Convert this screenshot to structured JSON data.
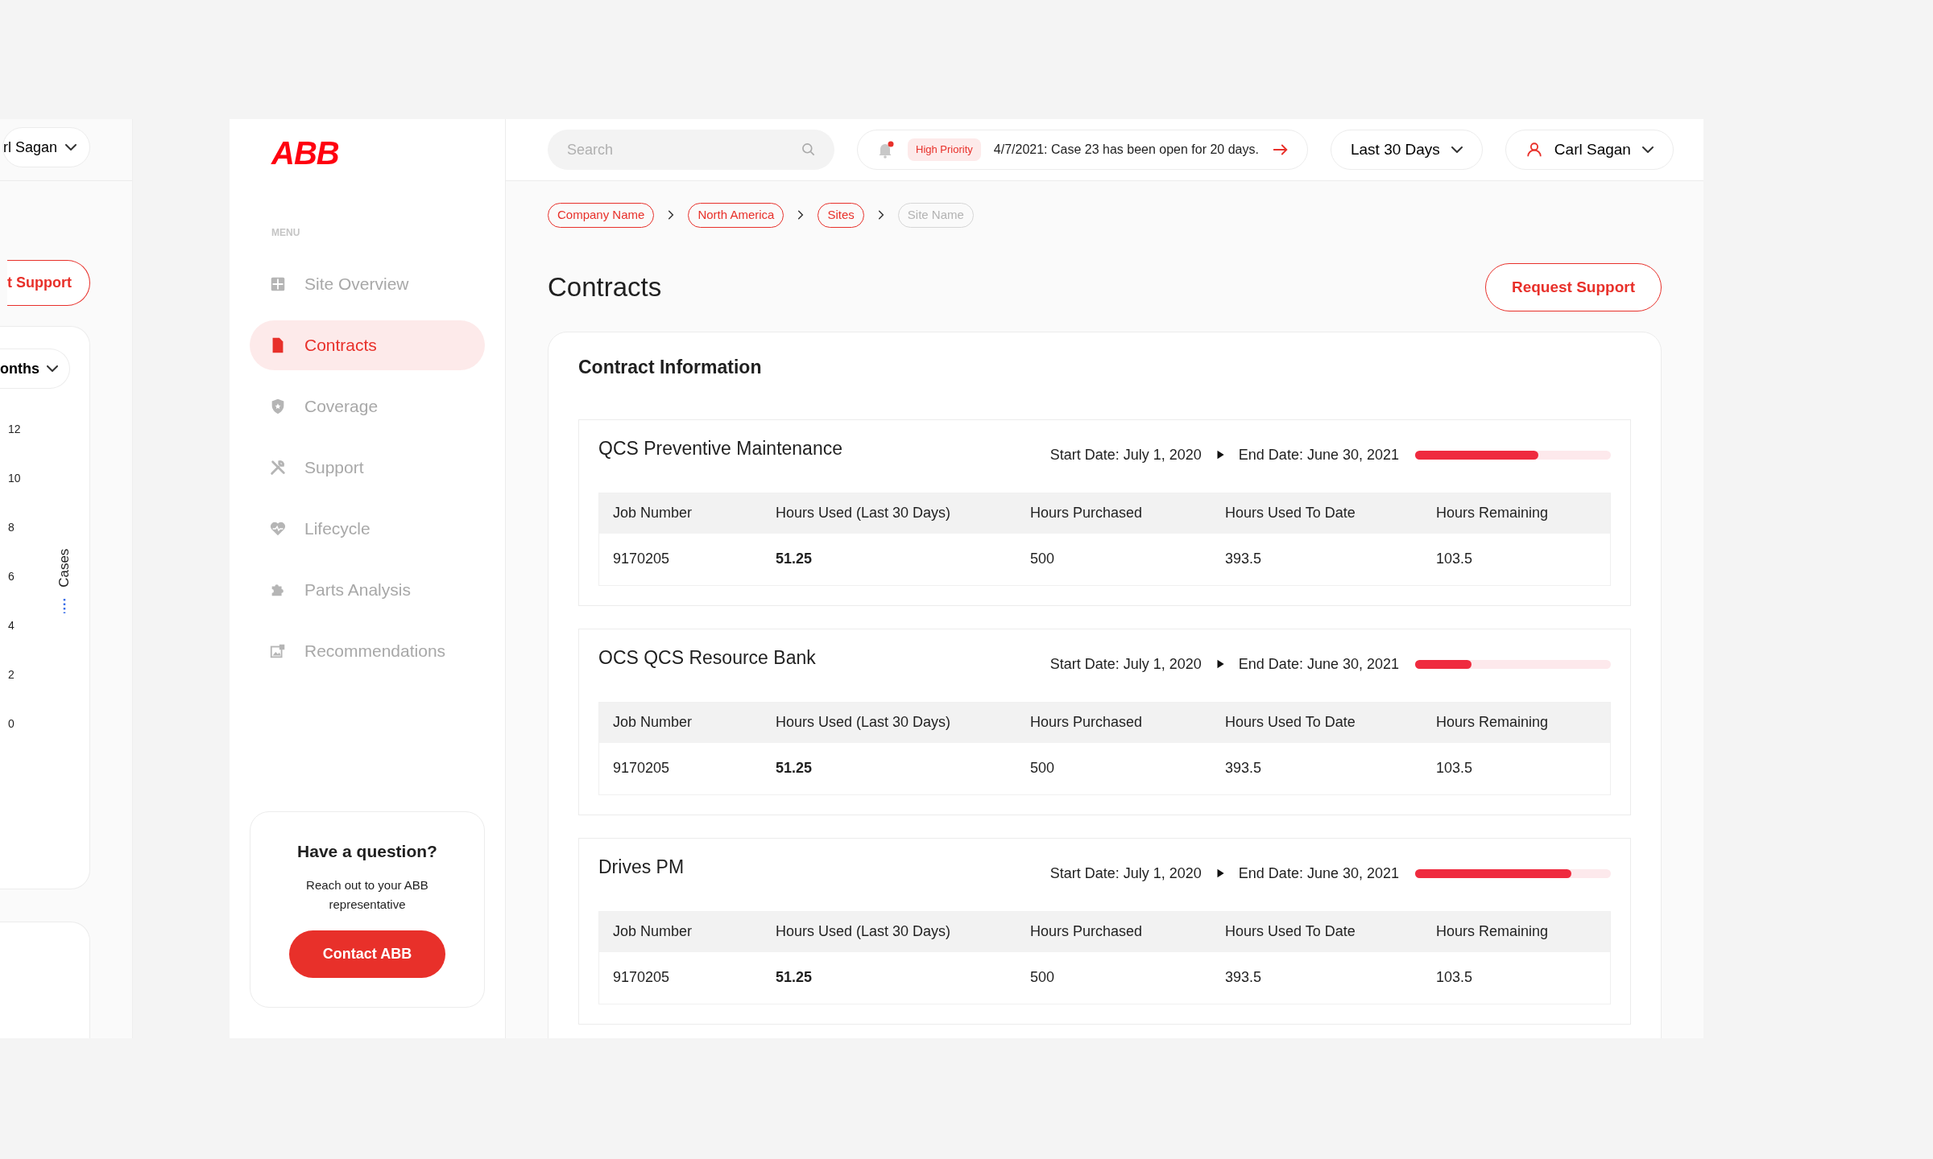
{
  "back_screen": {
    "user_button": "rl Sagan",
    "support_button": "t Support",
    "range_button": "onths",
    "y_ticks": [
      "12",
      "10",
      "8",
      "6",
      "4",
      "2",
      "0"
    ],
    "y_label": "Cases"
  },
  "sidebar": {
    "logo": "ABB",
    "menu_label": "MENU",
    "items": [
      {
        "label": "Site Overview",
        "selected": false
      },
      {
        "label": "Contracts",
        "selected": true
      },
      {
        "label": "Coverage",
        "selected": false
      },
      {
        "label": "Support",
        "selected": false
      },
      {
        "label": "Lifecycle",
        "selected": false
      },
      {
        "label": "Parts Analysis",
        "selected": false
      },
      {
        "label": "Recommendations",
        "selected": false
      }
    ],
    "help": {
      "title": "Have a question?",
      "text": "Reach out to your ABB representative",
      "button": "Contact ABB"
    }
  },
  "topbar": {
    "search": {
      "placeholder": "Search"
    },
    "notification": {
      "badge": "High Priority",
      "text": "4/7/2021: Case 23 has been open for 20 days.",
      "unread": true
    },
    "range": "Last 30 Days",
    "user": "Carl Sagan"
  },
  "breadcrumbs": [
    {
      "label": "Company Name",
      "current": false
    },
    {
      "label": "North America",
      "current": false
    },
    {
      "label": "Sites",
      "current": false
    },
    {
      "label": "Site Name",
      "current": true
    }
  ],
  "page": {
    "title": "Contracts",
    "action": "Request Support"
  },
  "card": {
    "title": "Contract Information",
    "contracts": [
      {
        "name": "QCS Preventive Maintenance",
        "start": "Start Date: July 1, 2020",
        "end": "End Date: June 30, 2021",
        "level": 0.63,
        "columns": [
          "Job Number",
          "Hours Used (Last 30 Days)",
          "Hours Purchased",
          "Hours Used To Date",
          "Hours Remaining"
        ],
        "row": [
          "9170205",
          "51.25",
          "500",
          "393.5",
          "103.5"
        ]
      },
      {
        "name": "OCS QCS Resource Bank",
        "start": "Start Date: July 1, 2020",
        "end": "End Date: June 30, 2021",
        "level": 0.29,
        "columns": [
          "Job Number",
          "Hours Used (Last 30 Days)",
          "Hours Purchased",
          "Hours Used To Date",
          "Hours Remaining"
        ],
        "row": [
          "9170205",
          "51.25",
          "500",
          "393.5",
          "103.5"
        ]
      },
      {
        "name": "Drives PM",
        "start": "Start Date: July 1, 2020",
        "end": "End Date: June 30, 2021",
        "level": 0.8,
        "columns": [
          "Job Number",
          "Hours Used (Last 30 Days)",
          "Hours Purchased",
          "Hours Used To Date",
          "Hours Remaining"
        ],
        "row": [
          "9170205",
          "51.25",
          "500",
          "393.5",
          "103.5"
        ]
      }
    ]
  }
}
